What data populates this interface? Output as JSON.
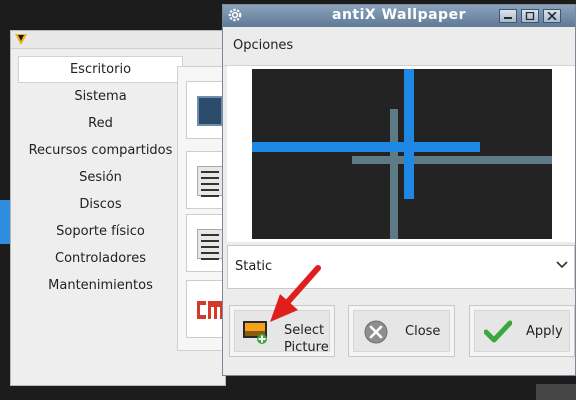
{
  "colors": {
    "accent_blue": "#1e88e5",
    "cross_gray": "#5e7a86",
    "titlebar": "#6f89a5",
    "arrow_red": "#e01e1e"
  },
  "background_window": {
    "logo_icon": "antix-logo-icon",
    "sidebar": [
      {
        "label": "Escritorio",
        "active": true
      },
      {
        "label": "Sistema"
      },
      {
        "label": "Red"
      },
      {
        "label": "Recursos compartidos"
      },
      {
        "label": "Sesión"
      },
      {
        "label": "Discos"
      },
      {
        "label": "Soporte físico"
      },
      {
        "label": "Controladores"
      },
      {
        "label": "Mantenimientos"
      }
    ]
  },
  "window": {
    "title": "antiX Wallpaper",
    "menu": "Opciones",
    "combo_value": "Static",
    "buttons": {
      "select": "Select Picture",
      "close": "Close",
      "apply": "Apply"
    }
  }
}
